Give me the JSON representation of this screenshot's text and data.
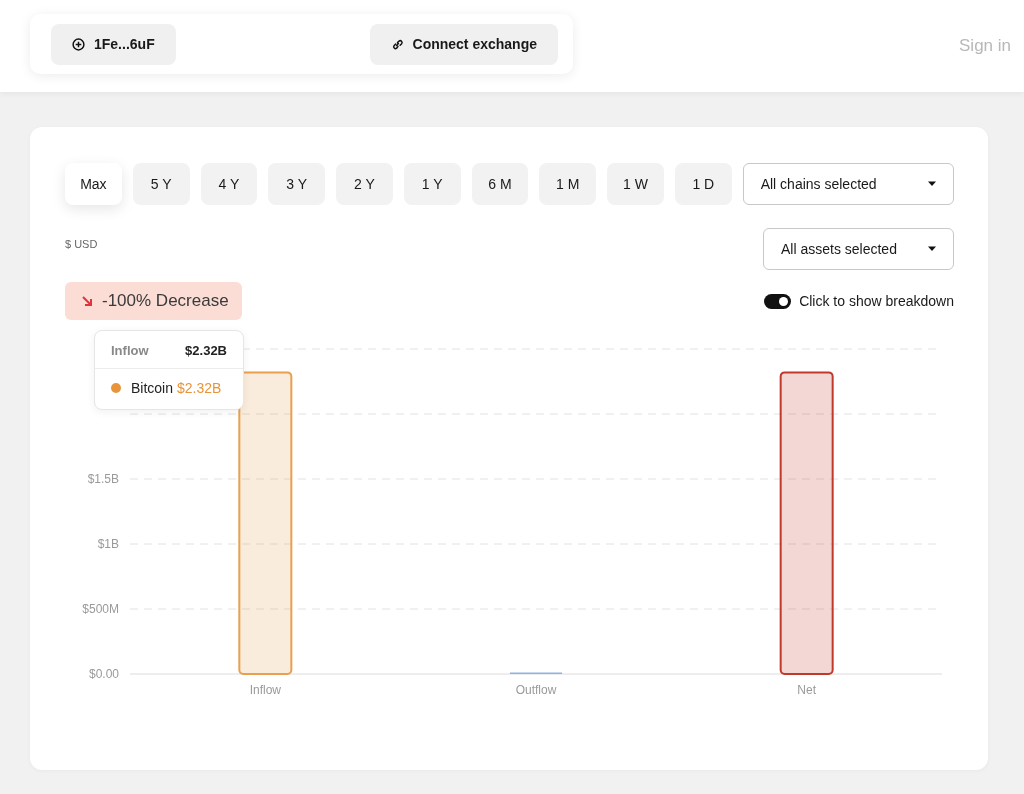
{
  "header": {
    "wallet_button": "1Fe...6uF",
    "connect_button": "Connect exchange",
    "sign_in": "Sign in"
  },
  "time_ranges": [
    {
      "label": "Max",
      "selected": true
    },
    {
      "label": "5 Y",
      "selected": false
    },
    {
      "label": "4 Y",
      "selected": false
    },
    {
      "label": "3 Y",
      "selected": false
    },
    {
      "label": "2 Y",
      "selected": false
    },
    {
      "label": "1 Y",
      "selected": false
    },
    {
      "label": "6 M",
      "selected": false
    },
    {
      "label": "1 M",
      "selected": false
    },
    {
      "label": "1 W",
      "selected": false
    },
    {
      "label": "1 D",
      "selected": false
    }
  ],
  "chains_dropdown": "All chains selected",
  "assets_dropdown": "All assets selected",
  "currency_label": "$ USD",
  "change_badge": {
    "text": "-100% Decrease"
  },
  "breakdown_toggle": {
    "label": "Click to show breakdown",
    "on": true
  },
  "tooltip": {
    "title": "Inflow",
    "total": "$2.32B",
    "items": [
      {
        "name": "Bitcoin",
        "value": "$2.32B",
        "color": "#e8943a"
      }
    ]
  },
  "chart_data": {
    "type": "bar",
    "categories": [
      "Inflow",
      "Outflow",
      "Net"
    ],
    "stacked": true,
    "grid": true,
    "ylim": [
      0,
      2500000000
    ],
    "yticks": [
      {
        "value": 0,
        "label": "$0.00"
      },
      {
        "value": 500000000,
        "label": "$500M"
      },
      {
        "value": 1000000000,
        "label": "$1B"
      },
      {
        "value": 1500000000,
        "label": "$1.5B"
      }
    ],
    "series": [
      {
        "color": "#e8a04e",
        "values": [
          2320000000,
          null,
          null
        ]
      },
      {
        "color": "#8fb4e0",
        "values": [
          null,
          0,
          null
        ]
      },
      {
        "color": "#c0392b",
        "values": [
          null,
          null,
          2320000000
        ]
      }
    ]
  }
}
